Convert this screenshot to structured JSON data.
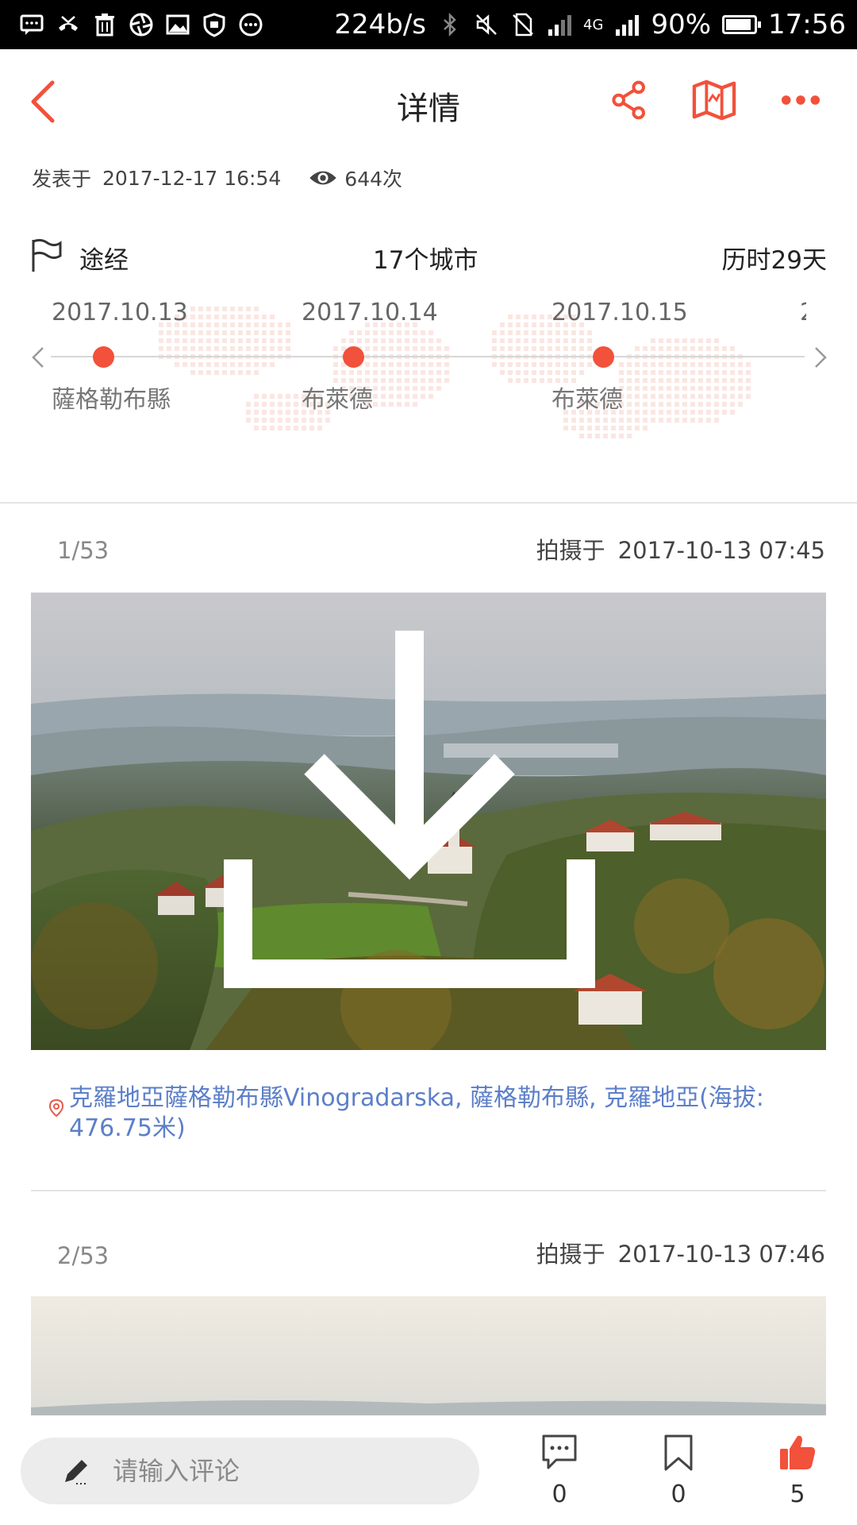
{
  "status_bar": {
    "speed": "224b/s",
    "network": "4G",
    "battery": "90%",
    "battery_level": 0.9,
    "time": "17:56"
  },
  "header": {
    "title": "详情"
  },
  "post_meta": {
    "posted_prefix": "发表于",
    "posted_time": "2017-12-17 16:54",
    "views": "644次"
  },
  "route": {
    "label": "途经",
    "cities": "17个城市",
    "duration": "历时29天",
    "stops": [
      {
        "date": "2017.10.13",
        "city": "薩格勒布縣"
      },
      {
        "date": "2017.10.14",
        "city": "布萊德"
      },
      {
        "date": "2017.10.15",
        "city": "布萊德"
      }
    ],
    "next_date_fragment": "2"
  },
  "photos": [
    {
      "index": "1/53",
      "taken_prefix": "拍摄于",
      "taken_time": "2017-10-13 07:45",
      "location": "克羅地亞薩格勒布縣Vinogradarska, 薩格勒布縣, 克羅地亞(海拔: 476.75米)"
    },
    {
      "index": "2/53",
      "taken_prefix": "拍摄于",
      "taken_time": "2017-10-13 07:46"
    }
  ],
  "bottom_bar": {
    "comment_placeholder": "请输入评论",
    "comments_count": "0",
    "bookmarks_count": "0",
    "likes_count": "5"
  },
  "colors": {
    "accent": "#f2513b",
    "link": "#5c7fc9"
  }
}
